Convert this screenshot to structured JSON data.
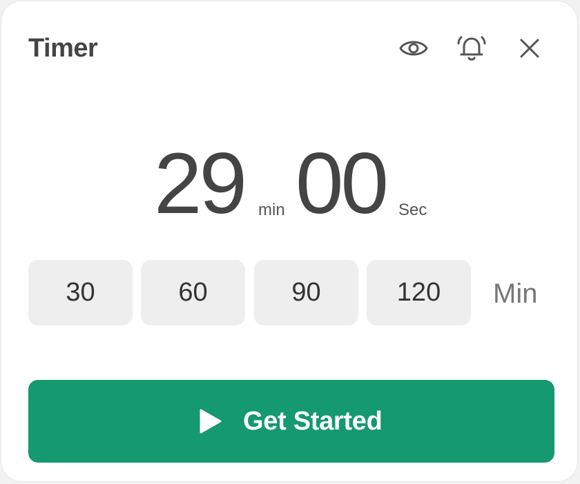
{
  "header": {
    "title": "Timer",
    "icons": [
      "eye-icon",
      "bell-icon",
      "close-icon"
    ]
  },
  "timer": {
    "minutes": "29",
    "minutes_unit": "min",
    "seconds": "00",
    "seconds_unit": "Sec"
  },
  "presets": {
    "options": [
      "30",
      "60",
      "90",
      "120"
    ],
    "unit_label": "Min"
  },
  "action": {
    "start_label": "Get Started",
    "icon": "play-icon"
  },
  "colors": {
    "accent": "#15996f",
    "text": "#444444",
    "preset_bg": "#eeeeee"
  }
}
